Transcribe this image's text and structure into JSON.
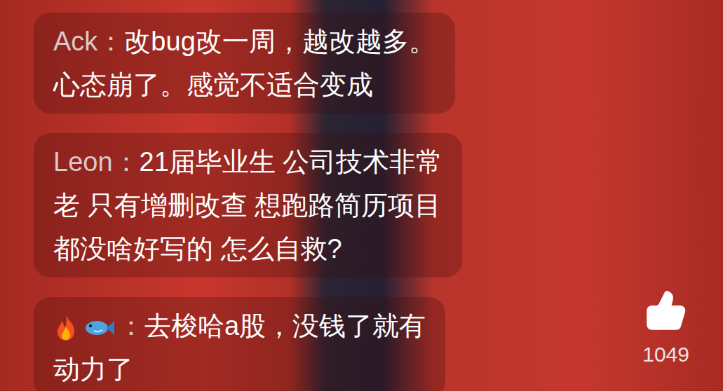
{
  "comments": [
    {
      "name": "Ack：",
      "name_kind": "text",
      "lines": [
        "改bug改一周，越改越多。",
        "心态崩了。感觉不适合变成"
      ]
    },
    {
      "name": "Leon：",
      "name_kind": "text",
      "lines": [
        "21届毕业生 公司技术非常",
        "老 只有增删改查 想跑路简历项目",
        "都没啥好写的 怎么自救?"
      ]
    },
    {
      "name": "：",
      "name_kind": "icons",
      "lines": [
        "去梭哈a股，没钱了就有",
        "动力了"
      ]
    }
  ],
  "likes": {
    "count": "1049"
  }
}
